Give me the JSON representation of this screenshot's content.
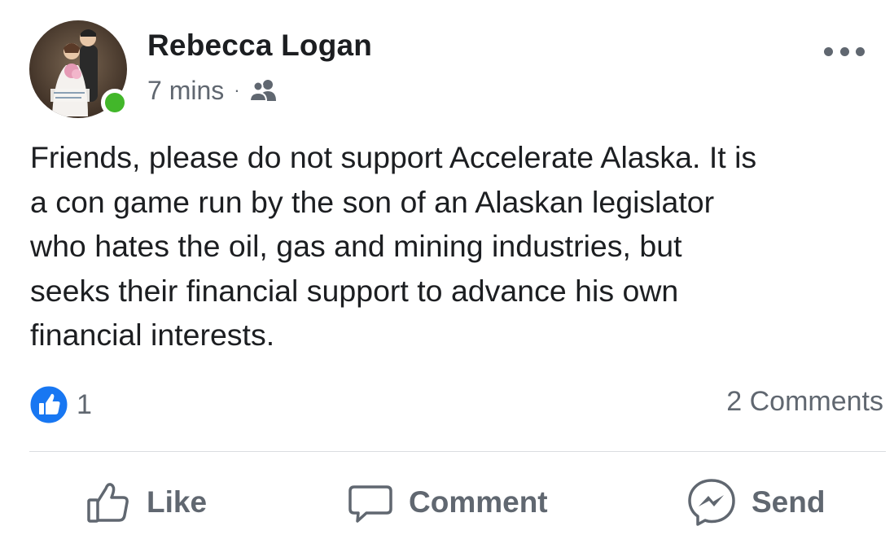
{
  "post": {
    "author": "Rebecca Logan",
    "time": "7 mins",
    "separator": "·",
    "audience_icon": "friends-icon",
    "online": true,
    "online_color": "#42b72a",
    "more_icon": "more-dots-icon",
    "text": "Friends, please do not support Accelerate Alaska.  It is\na con game run by the son of an Alaskan legislator\nwho hates the oil, gas and mining industries, but\nseeks their financial support to advance his own\nfinancial interests."
  },
  "stats": {
    "reaction_icon": "like-reaction-icon",
    "reaction_color": "#1877f2",
    "reaction_count": "1",
    "comments": "2 Comments"
  },
  "actions": {
    "like": {
      "label": "Like",
      "icon": "thumbs-up-icon"
    },
    "comment": {
      "label": "Comment",
      "icon": "speech-bubble-icon"
    },
    "send": {
      "label": "Send",
      "icon": "messenger-icon"
    }
  }
}
